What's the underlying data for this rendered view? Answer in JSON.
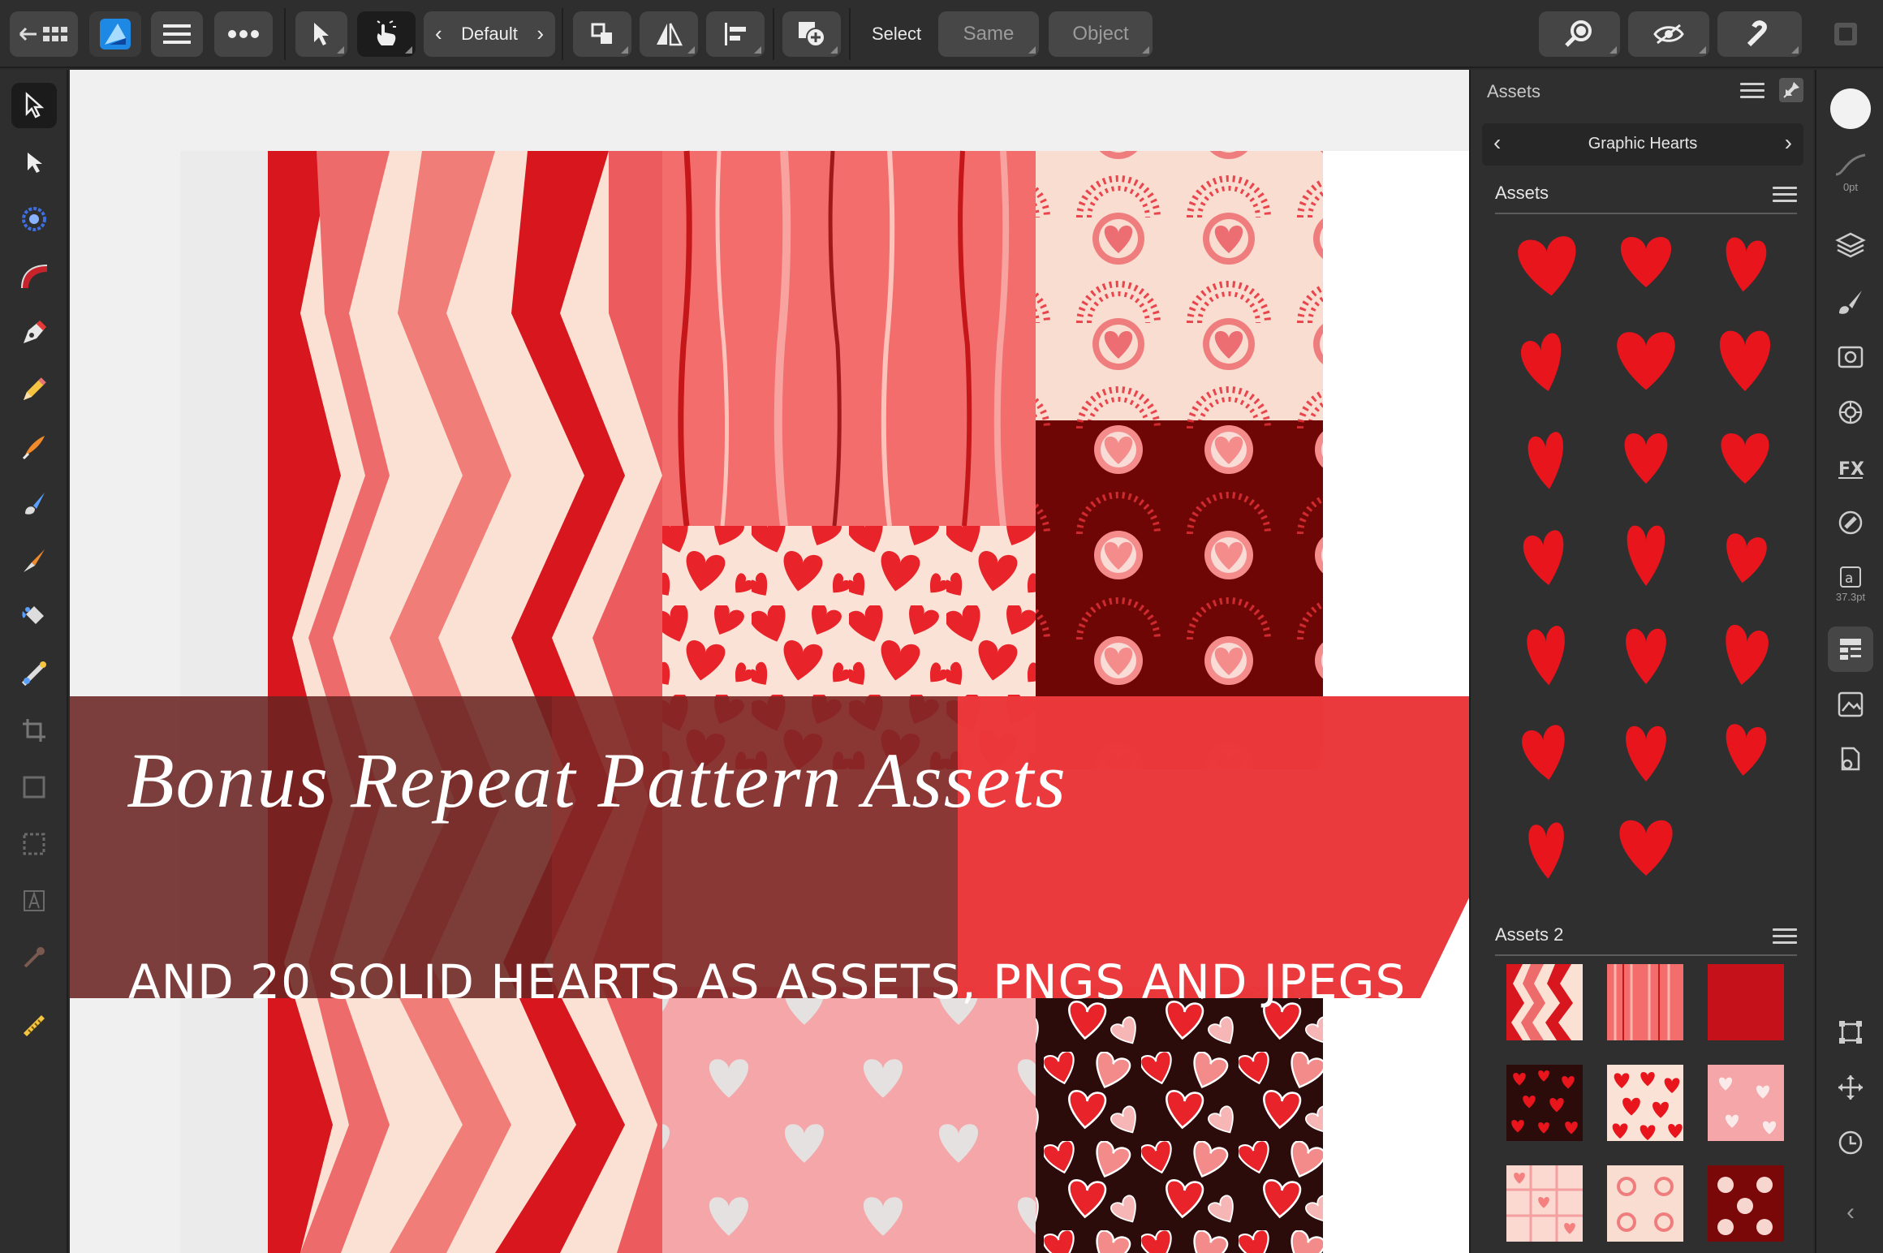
{
  "toolbar": {
    "persona_label": "Default",
    "select_label": "Select",
    "same_label": "Same",
    "object_label": "Object"
  },
  "panel": {
    "title": "Assets",
    "category": "Graphic Hearts",
    "section1_title": "Assets",
    "section2_title": "Assets 2",
    "heart_count": 20
  },
  "right_strip": {
    "stroke_width": "0pt",
    "font_size": "37.3pt"
  },
  "banner": {
    "script_title": "Bonus Repeat Pattern Assets",
    "subtitle": "AND 20 SOLID HEARTS AS ASSETS, PNGS AND JPEGS"
  },
  "colors": {
    "accent_red": "#e8151d",
    "banner_red": "#f4393d",
    "banner_dark": "#5a2320",
    "ui_dark": "#2e2e2e"
  }
}
